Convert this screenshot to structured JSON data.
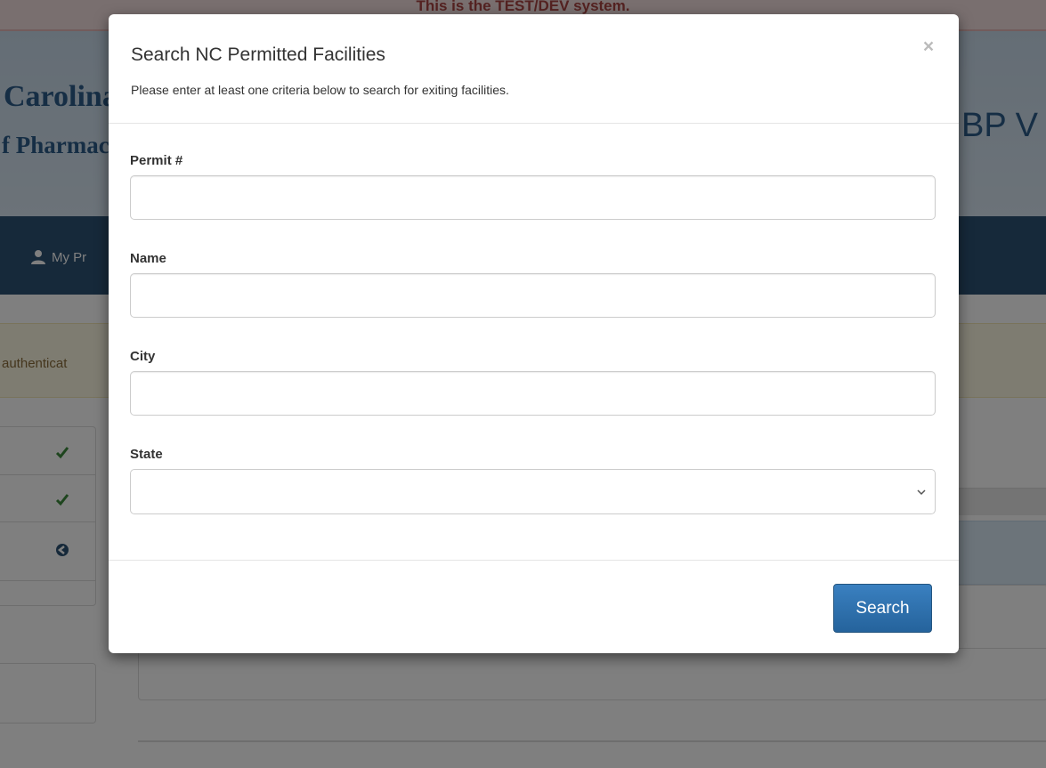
{
  "background": {
    "banner_text": "This is the TEST/DEV system.",
    "logo_line_1": "Carolina",
    "logo_line_2": "f Pharmacy",
    "hero_right": "BP V",
    "nav_item": "My Pr",
    "alert_text": "authenticat"
  },
  "modal": {
    "title": "Search NC Permitted Facilities",
    "subtitle": "Please enter at least one criteria below to search for exiting facilities.",
    "close_label": "×",
    "fields": {
      "permit": {
        "label": "Permit #",
        "value": ""
      },
      "name": {
        "label": "Name",
        "value": ""
      },
      "city": {
        "label": "City",
        "value": ""
      },
      "state": {
        "label": "State",
        "value": ""
      }
    },
    "search_label": "Search"
  },
  "colors": {
    "primary_button": "#2e6da4",
    "navbar": "#2d5375",
    "check_green": "#3d8b3d"
  },
  "icons": [
    "user-icon",
    "check-icon",
    "check-icon",
    "arrow-circle-left-icon",
    "close-icon",
    "chevron-down-icon"
  ]
}
